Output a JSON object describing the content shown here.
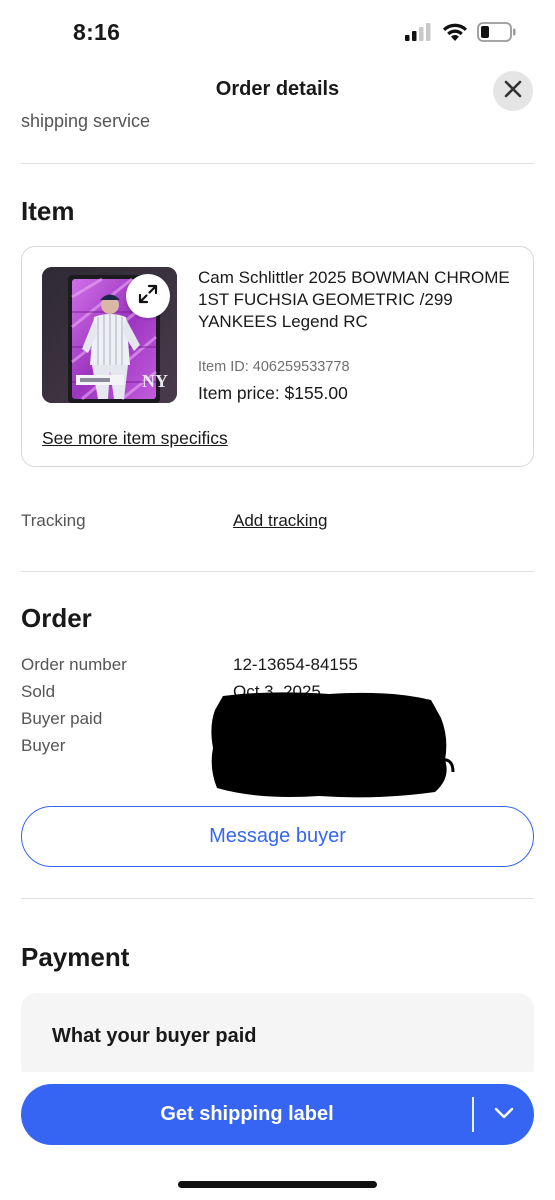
{
  "status_bar": {
    "time": "8:16"
  },
  "header": {
    "title": "Order details"
  },
  "previous_section": {
    "text": "shipping service"
  },
  "item_section": {
    "title": "Item",
    "item": {
      "title": "Cam Schlittler 2025 BOWMAN CHROME 1ST FUCHSIA GEOMETRIC /299 YANKEES Legend RC",
      "item_id": "Item ID: 406259533778",
      "price": "Item price: $155.00",
      "specifics_link": "See more item specifics"
    },
    "tracking_label": "Tracking",
    "tracking_link": "Add tracking"
  },
  "order_section": {
    "title": "Order",
    "rows": [
      {
        "label": "Order number",
        "value": "12-13654-84155"
      },
      {
        "label": "Sold",
        "value": "Oct 3, 2025"
      },
      {
        "label": "Buyer paid",
        "value": ""
      },
      {
        "label": "Buyer",
        "value": ""
      }
    ],
    "message_button": "Message buyer"
  },
  "payment_section": {
    "title": "Payment",
    "card_title": "What your buyer paid"
  },
  "bottom_bar": {
    "primary_button": "Get shipping label"
  },
  "colors": {
    "accent": "#3665f3",
    "text": "#191919",
    "secondary_text": "#555555",
    "card_purple": "#a23ec0"
  }
}
